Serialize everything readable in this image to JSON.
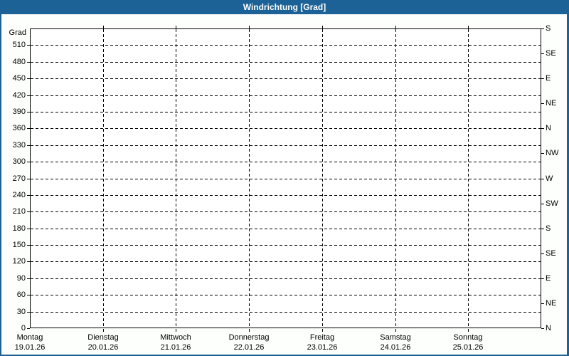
{
  "window": {
    "title": "Windrichtung [Grad]"
  },
  "colors": {
    "titlebar_blue": "#1d6296",
    "frame_blue": "#1d6296",
    "page_background": "#fcfffc",
    "plot_background": "#ffffff",
    "grid_color": "#000000",
    "title_text": "#ffffff"
  },
  "chart_data": {
    "type": "line",
    "title": "Windrichtung [Grad]",
    "ylabel": "Grad",
    "ylim": [
      0,
      540
    ],
    "y_tick_step": 30,
    "grid": true,
    "legend_position": "none",
    "left_axis_ticks": [
      0,
      30,
      60,
      90,
      120,
      150,
      180,
      210,
      240,
      270,
      300,
      330,
      360,
      390,
      420,
      450,
      480,
      510
    ],
    "right_axis_ticks": [
      {
        "value": 540,
        "label": "S"
      },
      {
        "value": 495,
        "label": "SE"
      },
      {
        "value": 450,
        "label": "E"
      },
      {
        "value": 405,
        "label": "NE"
      },
      {
        "value": 360,
        "label": "N"
      },
      {
        "value": 315,
        "label": "NW"
      },
      {
        "value": 270,
        "label": "W"
      },
      {
        "value": 225,
        "label": "SW"
      },
      {
        "value": 180,
        "label": "S"
      },
      {
        "value": 135,
        "label": "SE"
      },
      {
        "value": 90,
        "label": "E"
      },
      {
        "value": 45,
        "label": "NE"
      },
      {
        "value": 0,
        "label": "N"
      }
    ],
    "x_axis_days": [
      {
        "name": "Montag",
        "date": "19.01.26"
      },
      {
        "name": "Dienstag",
        "date": "20.01.26"
      },
      {
        "name": "Mittwoch",
        "date": "21.01.26"
      },
      {
        "name": "Donnerstag",
        "date": "22.01.26"
      },
      {
        "name": "Freitag",
        "date": "23.01.26"
      },
      {
        "name": "Samstag",
        "date": "24.01.26"
      },
      {
        "name": "Sonntag",
        "date": "25.01.26"
      }
    ],
    "series": []
  }
}
